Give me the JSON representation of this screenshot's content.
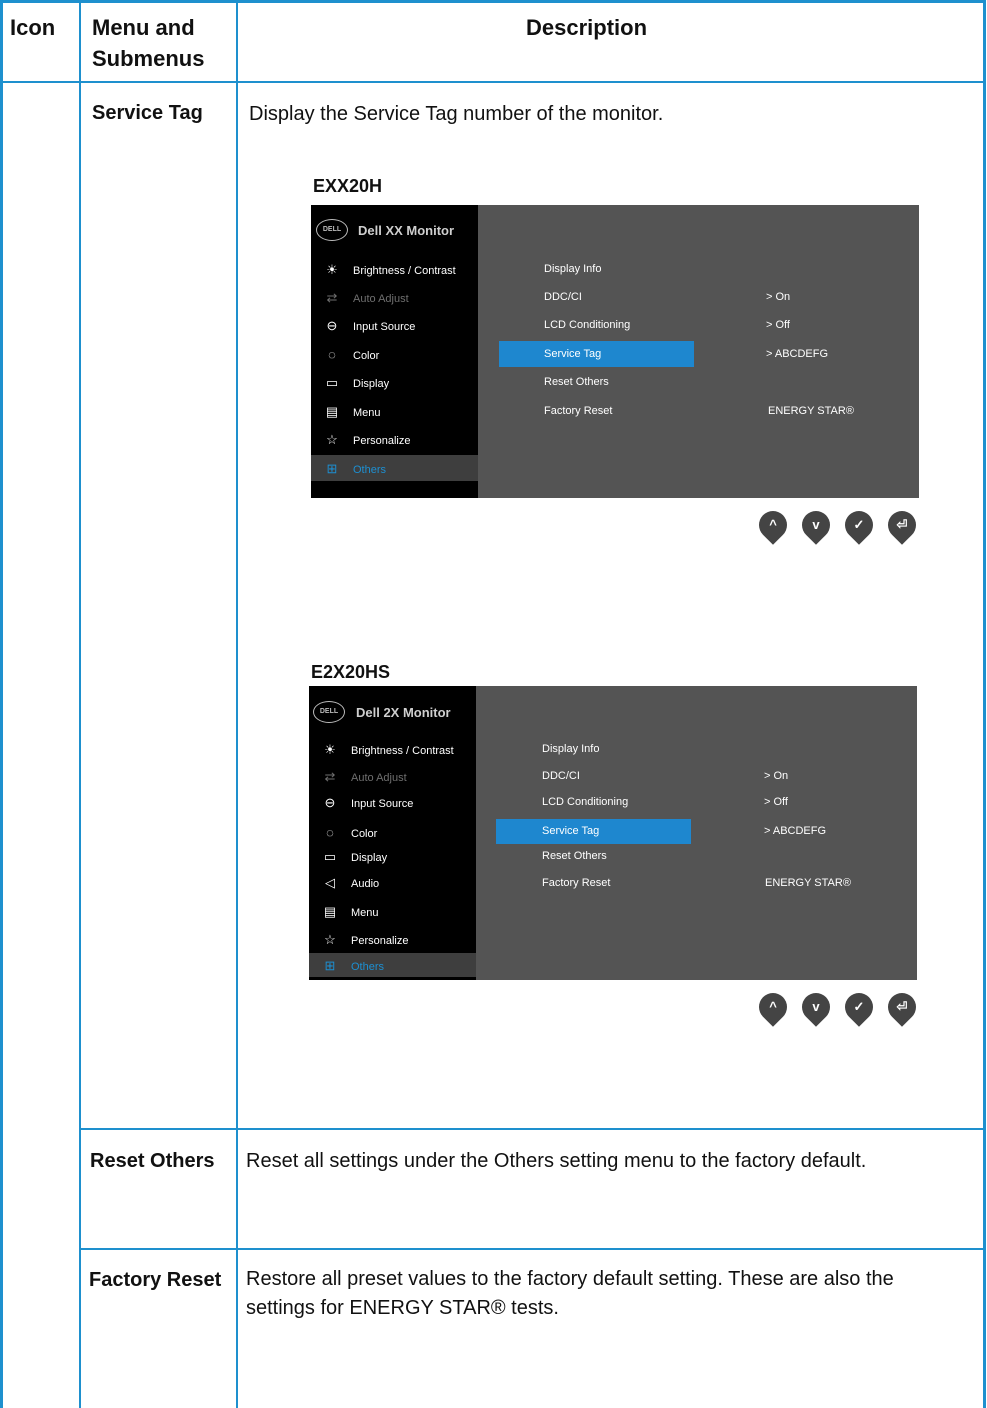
{
  "header": {
    "icon": "Icon",
    "menu_line1": "Menu and",
    "menu_line2": "Submenus",
    "description": "Description"
  },
  "rows": {
    "service_tag": {
      "label": "Service Tag",
      "description": "Display the Service Tag number of the monitor."
    },
    "reset_others": {
      "label": "Reset Others",
      "description": "Reset all settings under the Others setting menu to the factory default."
    },
    "factory_reset": {
      "label": "Factory Reset",
      "description": "Restore all preset values to the factory default setting. These are also the settings for ENERGY STAR® tests."
    }
  },
  "osd1": {
    "model": "EXX20H",
    "logo": "DELL",
    "title": "Dell XX Monitor",
    "menu": [
      "Brightness / Contrast",
      "Auto Adjust",
      "Input Source",
      "Color",
      "Display",
      "Menu",
      "Personalize",
      "Others"
    ],
    "submenu": [
      "Display Info",
      "DDC/CI",
      "LCD Conditioning",
      "Service Tag",
      "Reset Others",
      "Factory Reset"
    ],
    "values": [
      "> On",
      "> Off",
      "> ABCDEFG",
      "ENERGY STAR®"
    ]
  },
  "osd2": {
    "model": "E2X20HS",
    "logo": "DELL",
    "title": "Dell 2X Monitor",
    "menu": [
      "Brightness / Contrast",
      "Auto Adjust",
      "Input Source",
      "Color",
      "Display",
      "Audio",
      "Menu",
      "Personalize",
      "Others"
    ],
    "submenu": [
      "Display Info",
      "DDC/CI",
      "LCD Conditioning",
      "Service Tag",
      "Reset Others",
      "Factory Reset"
    ],
    "values": [
      "> On",
      "> Off",
      "> ABCDEFG",
      "ENERGY STAR®"
    ]
  },
  "buttons": {
    "up": "^",
    "down": "v",
    "ok": "✓",
    "back": "⏎"
  },
  "colors": {
    "border": "#1e90ce",
    "highlight": "#1e87cf",
    "osd_panel": "#545454",
    "osd_menu": "#000000"
  }
}
